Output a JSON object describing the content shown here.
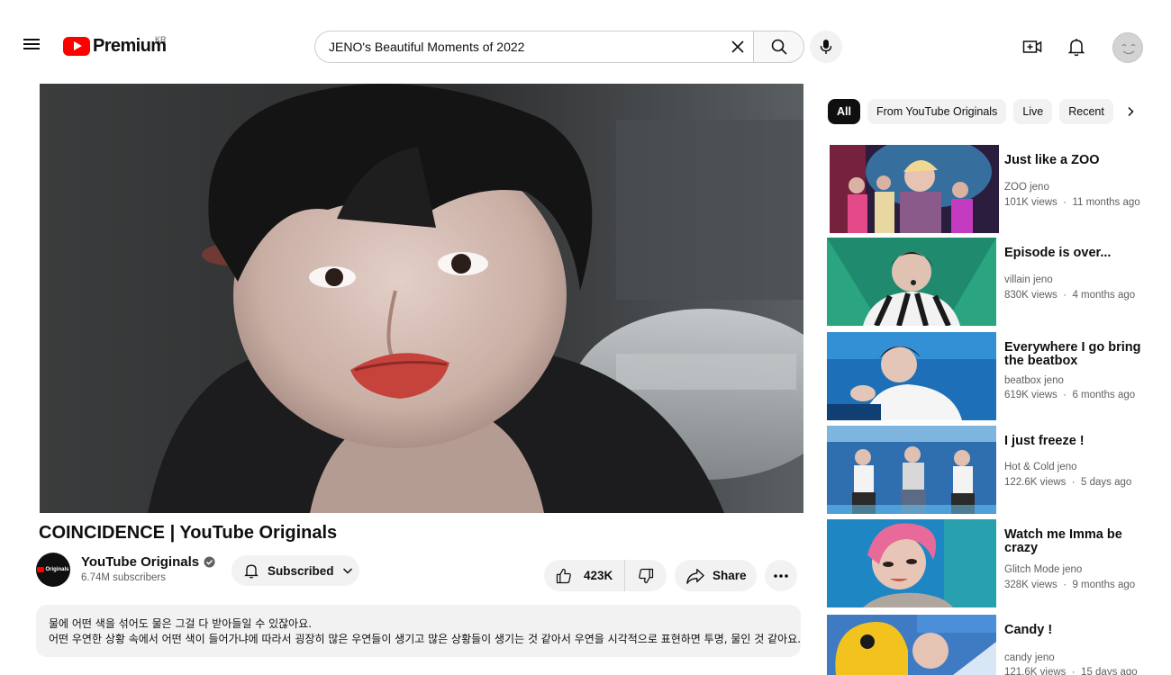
{
  "header": {
    "logo_text": "Premium",
    "country_code": "KR",
    "search_value": "JENO's Beautiful Moments of 2022",
    "search_placeholder": "Search"
  },
  "video": {
    "title": "COINCIDENCE | YouTube Originals",
    "channel_name": "YouTube Originals",
    "channel_avatar_text": "Originals",
    "subscribers": "6.74M subscribers",
    "subscribe_label": "Subscribed",
    "like_count": "423K",
    "share_label": "Share",
    "description_lines": [
      "물에 어떤 색을 섞어도 물은 그걸 다 받아들일 수 있잖아요.",
      "어떤 우연한 상황 속에서 어떤 색이 들어가냐에 따라서 굉장히 많은 우연들이 생기고 많은 상황들이 생기는 것 같아서 우연을 시각적으로 표현하면 투명, 물인 것 같아요."
    ]
  },
  "chips": [
    "All",
    "From YouTube Originals",
    "Live",
    "Recent"
  ],
  "recommendations": [
    {
      "title": "Just like a ZOO",
      "channel": "ZOO jeno",
      "views": "101K views",
      "age": "11 months ago"
    },
    {
      "title": "Episode is over...",
      "channel": "villain jeno",
      "views": "830K views",
      "age": "4 months ago"
    },
    {
      "title": "Everywhere I go bring the beatbox",
      "channel": "beatbox jeno",
      "views": "619K views",
      "age": "6 months ago"
    },
    {
      "title": "I just freeze !",
      "channel": "Hot & Cold jeno",
      "views": "122.6K views",
      "age": "5 days ago"
    },
    {
      "title": "Watch me Imma be crazy",
      "channel": "Glitch Mode jeno",
      "views": "328K views",
      "age": "9 months ago"
    },
    {
      "title": "Candy !",
      "channel": "candy jeno",
      "views": "121.6K views",
      "age": "15 days ago"
    }
  ],
  "colors": {
    "brand_red": "#ff0000",
    "text_primary": "#0f0f0f",
    "text_secondary": "#606060",
    "chip_bg": "#f2f2f2"
  }
}
